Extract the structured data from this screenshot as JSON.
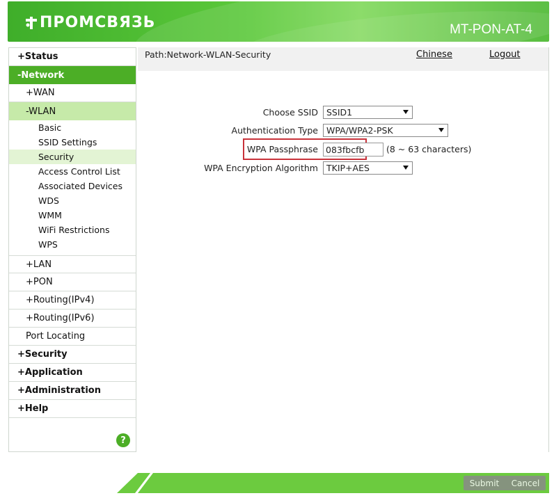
{
  "header": {
    "logo_text": "ПРОМСВЯЗЬ",
    "model": "MT-PON-AT-4"
  },
  "sidebar": {
    "items": [
      {
        "label": "+Status"
      },
      {
        "label": "-Network"
      },
      {
        "label": "+WAN"
      },
      {
        "label": "-WLAN"
      },
      {
        "label": "Basic"
      },
      {
        "label": "SSID Settings"
      },
      {
        "label": "Security"
      },
      {
        "label": "Access Control List"
      },
      {
        "label": "Associated Devices"
      },
      {
        "label": "WDS"
      },
      {
        "label": "WMM"
      },
      {
        "label": "WiFi Restrictions"
      },
      {
        "label": "WPS"
      },
      {
        "label": "+LAN"
      },
      {
        "label": "+PON"
      },
      {
        "label": "+Routing(IPv4)"
      },
      {
        "label": "+Routing(IPv6)"
      },
      {
        "label": "Port Locating"
      },
      {
        "label": "+Security"
      },
      {
        "label": "+Application"
      },
      {
        "label": "+Administration"
      },
      {
        "label": "+Help"
      }
    ],
    "help_icon": "?"
  },
  "main": {
    "path": "Path:Network-WLAN-Security",
    "chinese_link": "Chinese",
    "logout_link": "Logout",
    "form": {
      "ssid_label": "Choose SSID",
      "ssid_value": "SSID1",
      "auth_label": "Authentication Type",
      "auth_value": "WPA/WPA2-PSK",
      "pass_label": "WPA Passphrase",
      "pass_value": "083fbcfb",
      "pass_hint": "(8 ~ 63 characters)",
      "enc_label": "WPA Encryption Algorithm",
      "enc_value": "TKIP+AES"
    }
  },
  "footer": {
    "submit": "Submit",
    "cancel": "Cancel"
  },
  "colors": {
    "brand_green": "#4cae26",
    "highlight_red": "#c8323a"
  }
}
